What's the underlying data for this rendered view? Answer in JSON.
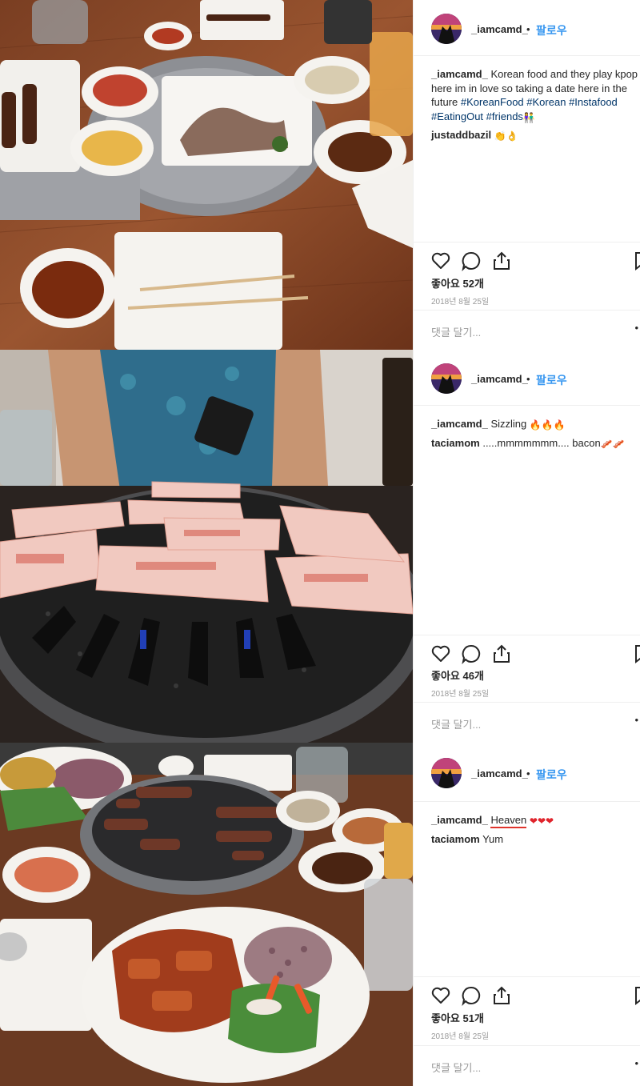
{
  "posts": [
    {
      "username": "_iamcamd_",
      "dot": "•",
      "follow": "팔로우",
      "caption_user": "_iamcamd_",
      "caption_text": "Korean food and they play kpop here im in love so taking a date here in the future",
      "hashtags": [
        "#KoreanFood",
        "#Korean",
        "#Instafood",
        "#EatingOut",
        "#friends"
      ],
      "caption_emoji": "👫",
      "comments": [
        {
          "user": "justaddbazil",
          "text": "",
          "emoji": "👏👌"
        }
      ],
      "likes": "좋아요 52개",
      "date": "2018년 8월 25일",
      "comment_placeholder": "댓글 달기...",
      "more": "•"
    },
    {
      "username": "_iamcamd_",
      "dot": "•",
      "follow": "팔로우",
      "caption_user": "_iamcamd_",
      "caption_text": "Sizzling",
      "caption_emoji": "🔥🔥🔥",
      "comments": [
        {
          "user": "taciamom",
          "text": ".....mmmmmmm.... bacon",
          "emoji": "🥓🥓"
        }
      ],
      "likes": "좋아요 46개",
      "date": "2018년 8월 25일",
      "comment_placeholder": "댓글 달기...",
      "more": "•"
    },
    {
      "username": "_iamcamd_",
      "dot": "•",
      "follow": "팔로우",
      "caption_user": "_iamcamd_",
      "caption_text": "Heaven",
      "caption_emoji": "❤❤❤",
      "comments": [
        {
          "user": "taciamom",
          "text": "Yum",
          "emoji": ""
        }
      ],
      "likes": "좋아요 51개",
      "date": "2018년 8월 25일",
      "comment_placeholder": "댓글 달기...",
      "more": "•"
    }
  ],
  "icons": [
    "heart-icon",
    "comment-icon",
    "share-icon",
    "bookmark-icon"
  ],
  "colors": {
    "link": "#3897f0",
    "hashtag": "#003569",
    "meta": "#999999",
    "border": "#efefef"
  }
}
